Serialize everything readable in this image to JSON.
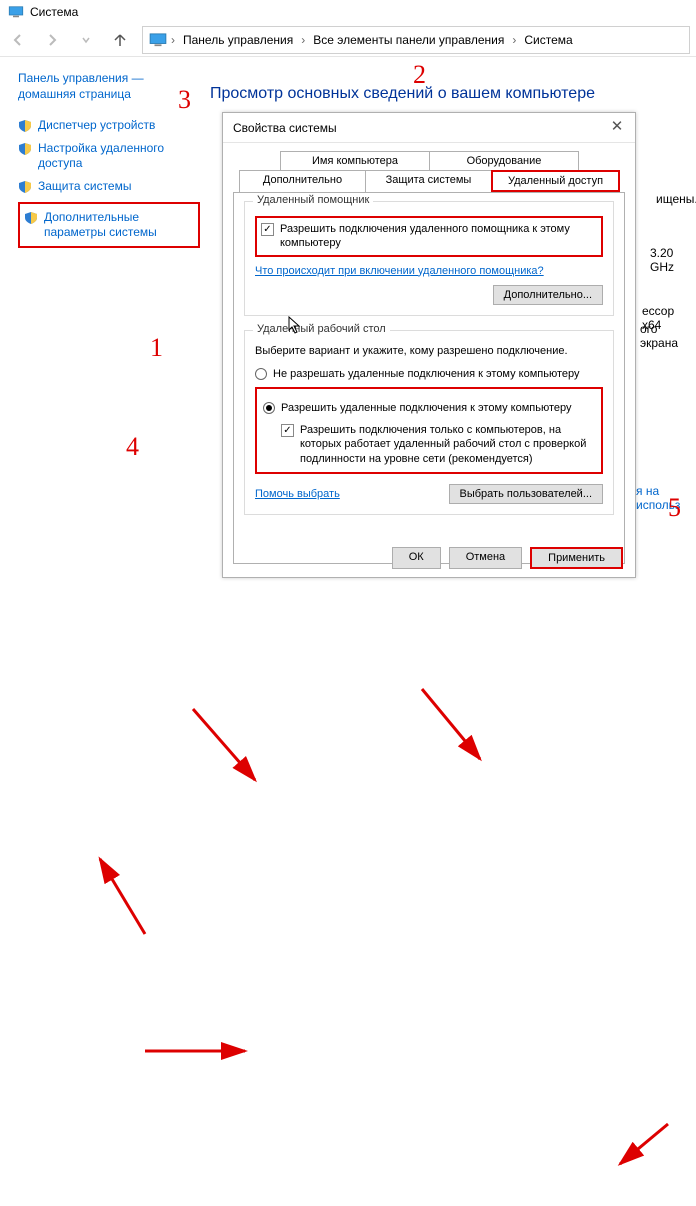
{
  "window": {
    "title": "Система"
  },
  "breadcrumb": {
    "items": [
      "Панель управления",
      "Все элементы панели управления",
      "Система"
    ]
  },
  "sidebar": {
    "home": "Панель управления — домашняя страница",
    "items": [
      "Диспетчер устройств",
      "Настройка удаленного доступа",
      "Защита системы",
      "Дополнительные параметры системы"
    ]
  },
  "page": {
    "heading": "Просмотр основных сведений о вашем компьютере"
  },
  "dialog": {
    "title": "Свойства системы",
    "tabs_row1": [
      "Имя компьютера",
      "Оборудование"
    ],
    "tabs_row2": [
      "Дополнительно",
      "Защита системы",
      "Удаленный доступ"
    ],
    "group_assistant": {
      "legend": "Удаленный помощник",
      "checkbox": "Разрешить подключения удаленного помощника к этому компьютеру",
      "help_link": "Что происходит при включении удаленного помощника?",
      "advanced_btn": "Дополнительно..."
    },
    "group_rdp": {
      "legend": "Удаленный рабочий стол",
      "instruction": "Выберите вариант и укажите, кому разрешено подключение.",
      "radio_deny": "Не разрешать удаленные подключения к этому компьютеру",
      "radio_allow": "Разрешить удаленные подключения к этому компьютеру",
      "nla_checkbox": "Разрешить подключения только с компьютеров, на которых работает удаленный рабочий стол с проверкой подлинности на уровне сети (рекомендуется)",
      "help_link": "Помочь выбрать",
      "select_users_btn": "Выбрать пользователей..."
    },
    "buttons": {
      "ok": "ОК",
      "cancel": "Отмена",
      "apply": "Применить"
    }
  },
  "clipped": {
    "t1": "ищены.",
    "t2": "3.20 GHz",
    "t3": "ессор x64",
    "t4": "ого экрана",
    "t5": "я на использ"
  },
  "anno": {
    "n1": "1",
    "n2": "2",
    "n3": "3",
    "n4": "4",
    "n5": "5"
  }
}
